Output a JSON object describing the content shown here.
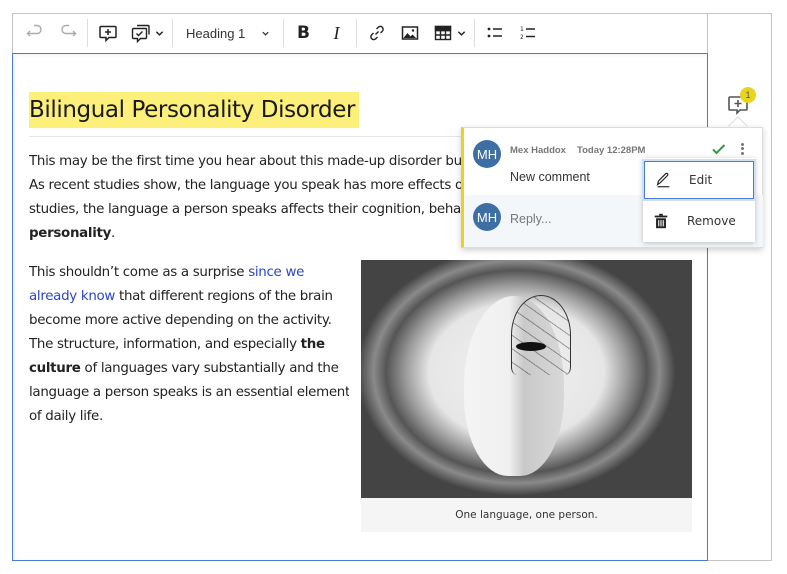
{
  "toolbar": {
    "undo": {
      "icon": "undo-icon",
      "label": "Undo",
      "disabled": true
    },
    "redo": {
      "icon": "redo-icon",
      "label": "Redo",
      "disabled": true
    },
    "add_comment": {
      "icon": "add-comment-icon",
      "label": "Add comment"
    },
    "track_changes": {
      "icon": "comments-check-icon",
      "label": "Comments"
    },
    "heading_select": {
      "value": "Heading 1"
    },
    "bold": {
      "icon": "bold-icon",
      "glyph": "B"
    },
    "italic": {
      "icon": "italic-icon",
      "glyph": "I"
    },
    "link": {
      "icon": "link-icon"
    },
    "image": {
      "icon": "image-icon"
    },
    "table": {
      "icon": "table-icon"
    },
    "bulleted_list": {
      "icon": "bulleted-list-icon"
    },
    "numbered_list": {
      "icon": "numbered-list-icon"
    }
  },
  "document": {
    "title": "Bilingual Personality Disorder",
    "paragraph1": {
      "lines": [
        "This may be the first time you hear about this made-up disorder but it",
        "As recent studies show, the language you speak has more effects on yo",
        "studies, the language a person speaks affects their cognition, behavio"
      ],
      "bold_end": "personality",
      "end_punct": "."
    },
    "paragraph2": {
      "text_before_link": "This shouldn’t come as a surprise ",
      "link_line1": "since we",
      "link_line2": "already know",
      "line2_rest": " that different regions of the brain",
      "line3": "become more active depending on the activity.",
      "line4_before_bold": "The structure, information, and especially ",
      "line4_bold": "the",
      "line5_bold": "culture",
      "line5_rest": " of languages vary substantially and the",
      "line6": "language a person speaks is an essential element",
      "line7": "of daily life."
    },
    "figure": {
      "image_alt": "Phrenology head seen through a glass",
      "caption": "One language, one person."
    }
  },
  "comments": {
    "marker_count": "1",
    "highlight_color": "#e8d31e",
    "thread": {
      "avatar_initials": "MH",
      "author": "Mex Haddox",
      "time": "Today 12:28PM",
      "text": "New comment",
      "reply_avatar_initials": "MH",
      "reply_placeholder": "Reply..."
    },
    "menu": {
      "items": [
        {
          "label": "Edit",
          "icon": "pencil-icon"
        },
        {
          "label": "Remove",
          "icon": "trash-icon"
        }
      ]
    }
  },
  "colors": {
    "accent": "#4a7bd4",
    "heading_highlight": "#fcf07a",
    "link": "#2b45c9",
    "avatar": "#3d6fa5",
    "resolve_check": "#2e9b3c"
  }
}
